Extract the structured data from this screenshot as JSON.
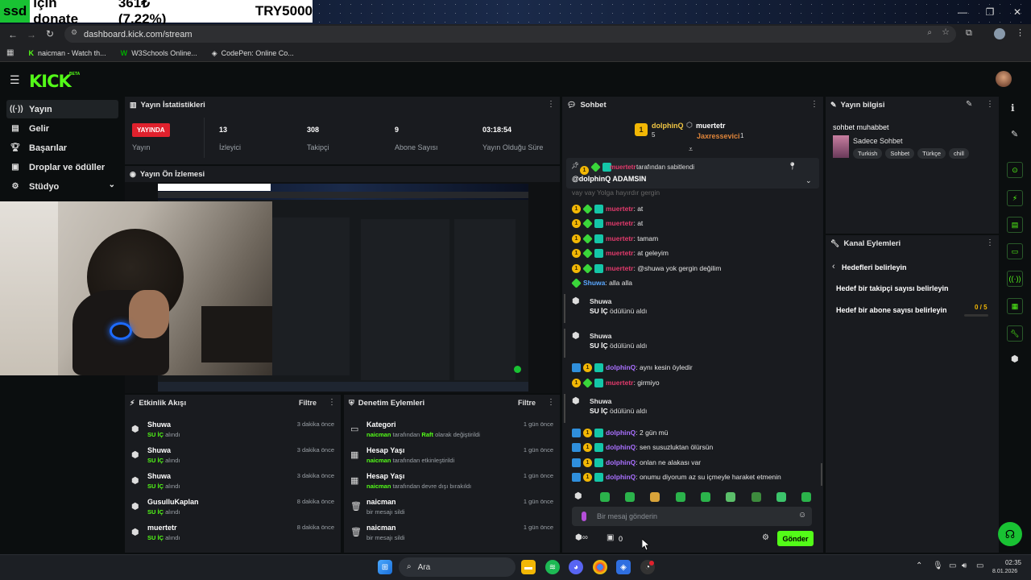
{
  "ticker": {
    "brand": "ssd",
    "text": "için donate",
    "amount": "361₺ (7.22%)",
    "currency": "TRY5000"
  },
  "browser": {
    "url": "dashboard.kick.com/stream",
    "bookmarks": [
      "naicman - Watch th...",
      "W3Schools Online...",
      "CodePen: Online Co..."
    ]
  },
  "kick": {
    "logo": "KICK",
    "beta": "BETA"
  },
  "sidebar": {
    "items": [
      {
        "label": "Yayın",
        "icon": "broadcast-icon"
      },
      {
        "label": "Gelir",
        "icon": "revenue-icon"
      },
      {
        "label": "Başarılar",
        "icon": "trophy-icon"
      },
      {
        "label": "Droplar ve ödüller",
        "icon": "gift-icon"
      },
      {
        "label": "Stüdyo",
        "icon": "studio-icon"
      }
    ]
  },
  "stats": {
    "title": "Yayın İstatistikleri",
    "live_badge": "YAYINDA",
    "live_label": "Yayın",
    "viewers": "13",
    "viewers_label": "İzleyici",
    "followers": "308",
    "followers_label": "Takipçi",
    "subs": "9",
    "subs_label": "Abone Sayısı",
    "duration": "03:18:54",
    "duration_label": "Yayın Olduğu Süre"
  },
  "preview": {
    "title": "Yayın Ön İzlemesi"
  },
  "activity": {
    "title": "Etkinlik Akışı",
    "filter": "Filtre",
    "items": [
      {
        "name": "Shuwa",
        "reward": "SU İÇ",
        "action": "alındı",
        "time": "3 dakika önce"
      },
      {
        "name": "Shuwa",
        "reward": "SU İÇ",
        "action": "alındı",
        "time": "3 dakika önce"
      },
      {
        "name": "Shuwa",
        "reward": "SU İÇ",
        "action": "alındı",
        "time": "3 dakika önce"
      },
      {
        "name": "GusulluKaplan",
        "reward": "SU İÇ",
        "action": "alındı",
        "time": "8 dakika önce"
      },
      {
        "name": "muertetr",
        "reward": "SU İÇ",
        "action": "alındı",
        "time": "8 dakika önce"
      }
    ]
  },
  "moderation": {
    "title": "Denetim Eylemleri",
    "filter": "Filtre",
    "items": [
      {
        "title": "Kategori",
        "actor": "naicman",
        "detail_pre": "tarafından",
        "detail_bold": "Raft",
        "detail_post": "olarak değiştirildi",
        "time": "1 gün önce"
      },
      {
        "title": "Hesap Yaşı",
        "actor": "naicman",
        "detail_pre": "tarafından etkinleştirildi",
        "detail_bold": "",
        "detail_post": "",
        "time": "1 gün önce"
      },
      {
        "title": "Hesap Yaşı",
        "actor": "naicman",
        "detail_pre": "tarafından devre dışı bırakıldı",
        "detail_bold": "",
        "detail_post": "",
        "time": "1 gün önce"
      },
      {
        "title": "naicman",
        "actor": "",
        "detail_pre": "bir mesajı sildi",
        "detail_bold": "",
        "detail_post": "",
        "time": "1 gün önce"
      },
      {
        "title": "naicman",
        "actor": "",
        "detail_pre": "bir mesajı sildi",
        "detail_bold": "",
        "detail_post": "",
        "time": "1 gün önce"
      }
    ]
  },
  "chat": {
    "title": "Sohbet",
    "top1": {
      "name": "dolphinQ",
      "count": "5"
    },
    "top2": {
      "name": "muertetr"
    },
    "top3": {
      "name": "Jaxressevici",
      "count": "1"
    },
    "pinned_by": "tarafından sabitlendi",
    "pinned_user": "muertetr",
    "pinned_msg": "@dolphinQ ADAMSIN",
    "cut_line": "vay vay Yolga hayırdır gergin",
    "messages": [
      {
        "user": "muertetr",
        "text": ": at",
        "color": "red"
      },
      {
        "user": "muertetr",
        "text": ": at",
        "color": "red"
      },
      {
        "user": "muertetr",
        "text": ": tamam",
        "color": "red"
      },
      {
        "user": "muertetr",
        "text": ": at geleyim",
        "color": "red"
      },
      {
        "user": "muertetr",
        "text": ": @shuwa yok gergin değilim",
        "color": "red"
      },
      {
        "user": "Shuwa",
        "text": ": alla alla",
        "color": "blue"
      }
    ],
    "sys1": {
      "user": "Shuwa",
      "reward": "SU İÇ",
      "text": "ödülünü aldı"
    },
    "sys2": {
      "user": "Shuwa",
      "reward": "SU İÇ",
      "text": "ödülünü aldı"
    },
    "messages2": [
      {
        "user": "dolphinQ",
        "text": ": aynı kesin öyledir",
        "color": "purple"
      },
      {
        "user": "muertetr",
        "text": ": girmiyo",
        "color": "red"
      }
    ],
    "sys3": {
      "user": "Shuwa",
      "reward": "SU İÇ",
      "text": "ödülünü aldı"
    },
    "messages3": [
      {
        "user": "dolphinQ",
        "text": ": 2 gün mü",
        "color": "purple"
      },
      {
        "user": "dolphinQ",
        "text": ": sen susuzluktan ölürsün",
        "color": "purple"
      },
      {
        "user": "dolphinQ",
        "text": ": onlan ne alakası var",
        "color": "purple"
      },
      {
        "user": "dolphinQ",
        "text": ": onumu diyorum az su içmeyle haraket etmenin",
        "color": "purple"
      }
    ],
    "input_placeholder": "Bir mesaj gönderin",
    "points": "0",
    "send": "Gönder"
  },
  "info": {
    "title": "Yayın bilgisi",
    "stream_title": "sohbet muhabbet",
    "category": "Sadece Sohbet",
    "tags": [
      "Turkish",
      "Sohbet",
      "Türkçe",
      "chill"
    ]
  },
  "channel": {
    "title": "Kanal Eylemleri",
    "back": "Hedefleri belirleyin",
    "goal1": "Hedef bir takipçi sayısı belirleyin",
    "goal2": "Hedef bir abone sayısı belirleyin",
    "goal2_progress": "0 / 5",
    "goal2_fraction": 0
  },
  "taskbar": {
    "search": "Ara",
    "time": "02:35",
    "date": "8.01.2026"
  },
  "colors": {
    "accent": "#53fc18",
    "live": "#e0212d",
    "panel": "#191b1f"
  }
}
